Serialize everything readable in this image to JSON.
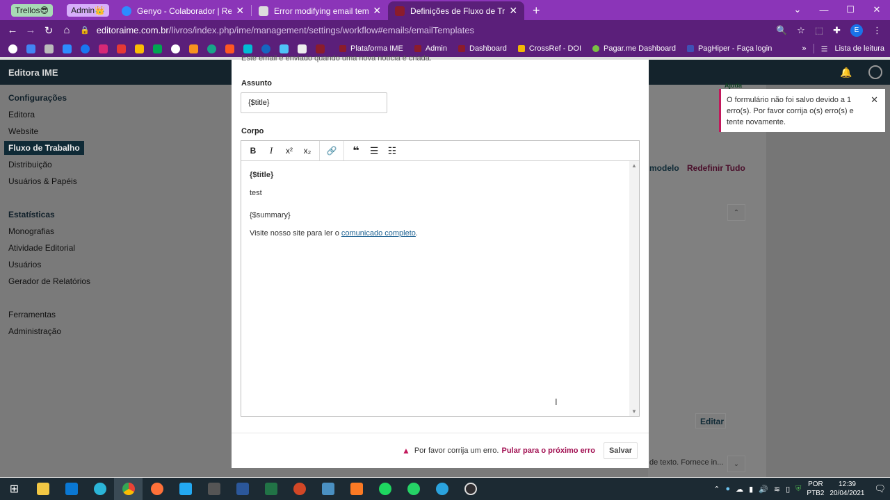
{
  "browser": {
    "tab_groups": [
      {
        "label": "Trellos😎",
        "color": "#a8dab5"
      },
      {
        "label": "Admin👑",
        "color": "#d7aefb"
      }
    ],
    "tabs": [
      {
        "title": "Genyo - Colaborador | Registro d",
        "favicon_color": "#2d8cff"
      },
      {
        "title": "Error modifying email template -",
        "favicon_color": "#dddddd"
      },
      {
        "title": "Definições de Fluxo de Trabalho",
        "favicon_color": "#8b1c2c"
      }
    ],
    "url_host": "editoraime.com.br",
    "url_path": "/livros/index.php/ime/management/settings/workflow#emails/emailTemplates",
    "profile_initial": "E",
    "bookmarks": [
      {
        "label": "Plataforma IME",
        "color": "#8b1c2c"
      },
      {
        "label": "Admin",
        "color": "#8b1c2c"
      },
      {
        "label": "Dashboard",
        "color": "#8b1c2c"
      },
      {
        "label": "CrossRef - DOI",
        "color": "#f2b705"
      },
      {
        "label": "Pagar.me Dashboard",
        "color": "#7ac143"
      },
      {
        "label": "PagHiper - Faça login",
        "color": "#3f51b5"
      }
    ],
    "reading_list": "Lista de leitura"
  },
  "app": {
    "brand": "Editora IME",
    "sidebar": {
      "section1": "Configurações",
      "items1": [
        "Editora",
        "Website",
        "Fluxo de Trabalho",
        "Distribuição",
        "Usuários & Papéis"
      ],
      "section2": "Estatísticas",
      "items2": [
        "Monografias",
        "Atividade Editorial",
        "Usuários",
        "Gerador de Relatórios"
      ],
      "items3": [
        "Ferramentas",
        "Administração"
      ]
    },
    "background": {
      "help": "Ajuda",
      "model_btn": "modelo",
      "reset_all": "Redefinir Tudo",
      "edit_btn": "Editar",
      "text_snippet": "de texto. Fornece in..."
    }
  },
  "modal": {
    "intro_text": "Este email é enviado quando uma nova notícia é criada.",
    "subject_label": "Assunto",
    "subject_value": "{$title}",
    "body_label": "Corpo",
    "body_title": "{$title}",
    "body_line1": "test",
    "body_summary": "{$summary}",
    "body_visit_prefix": "Visite nosso site para ler o ",
    "body_visit_link": "comunicado completo",
    "body_visit_suffix": ".",
    "footer_error": "Por favor corrija um erro.",
    "footer_link": "Pular para o próximo erro",
    "save_label": "Salvar"
  },
  "notification": {
    "message": "O formulário não foi salvo devido a 1 erro(s). Por favor corrija o(s) erro(s) e tente novamente."
  },
  "taskbar": {
    "lang1": "POR",
    "lang2": "PTB2",
    "time": "12:39",
    "date": "20/04/2021"
  }
}
